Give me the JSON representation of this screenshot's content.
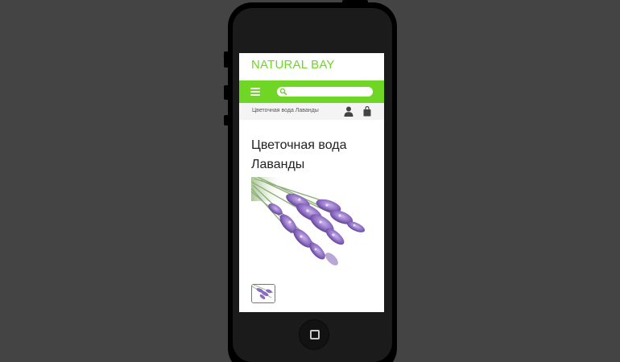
{
  "app": {
    "brand_name": "NATURAL BAY",
    "accent_color": "#6fd626"
  },
  "navbar": {
    "menu_icon": "hamburger-menu-icon",
    "search": {
      "icon": "search-icon",
      "value": "",
      "placeholder": ""
    }
  },
  "breadcrumb": {
    "current": "Цветочная вода Лаванды",
    "account_icon": "user-icon",
    "cart_icon": "shopping-bag-icon"
  },
  "product": {
    "title": "Цветочная вода Лаванды",
    "image": "lavender-flowers-photo",
    "thumbnail": "lavender-flowers-thumbnail"
  },
  "device": {
    "home_button_icon": "home-button-square-icon"
  }
}
